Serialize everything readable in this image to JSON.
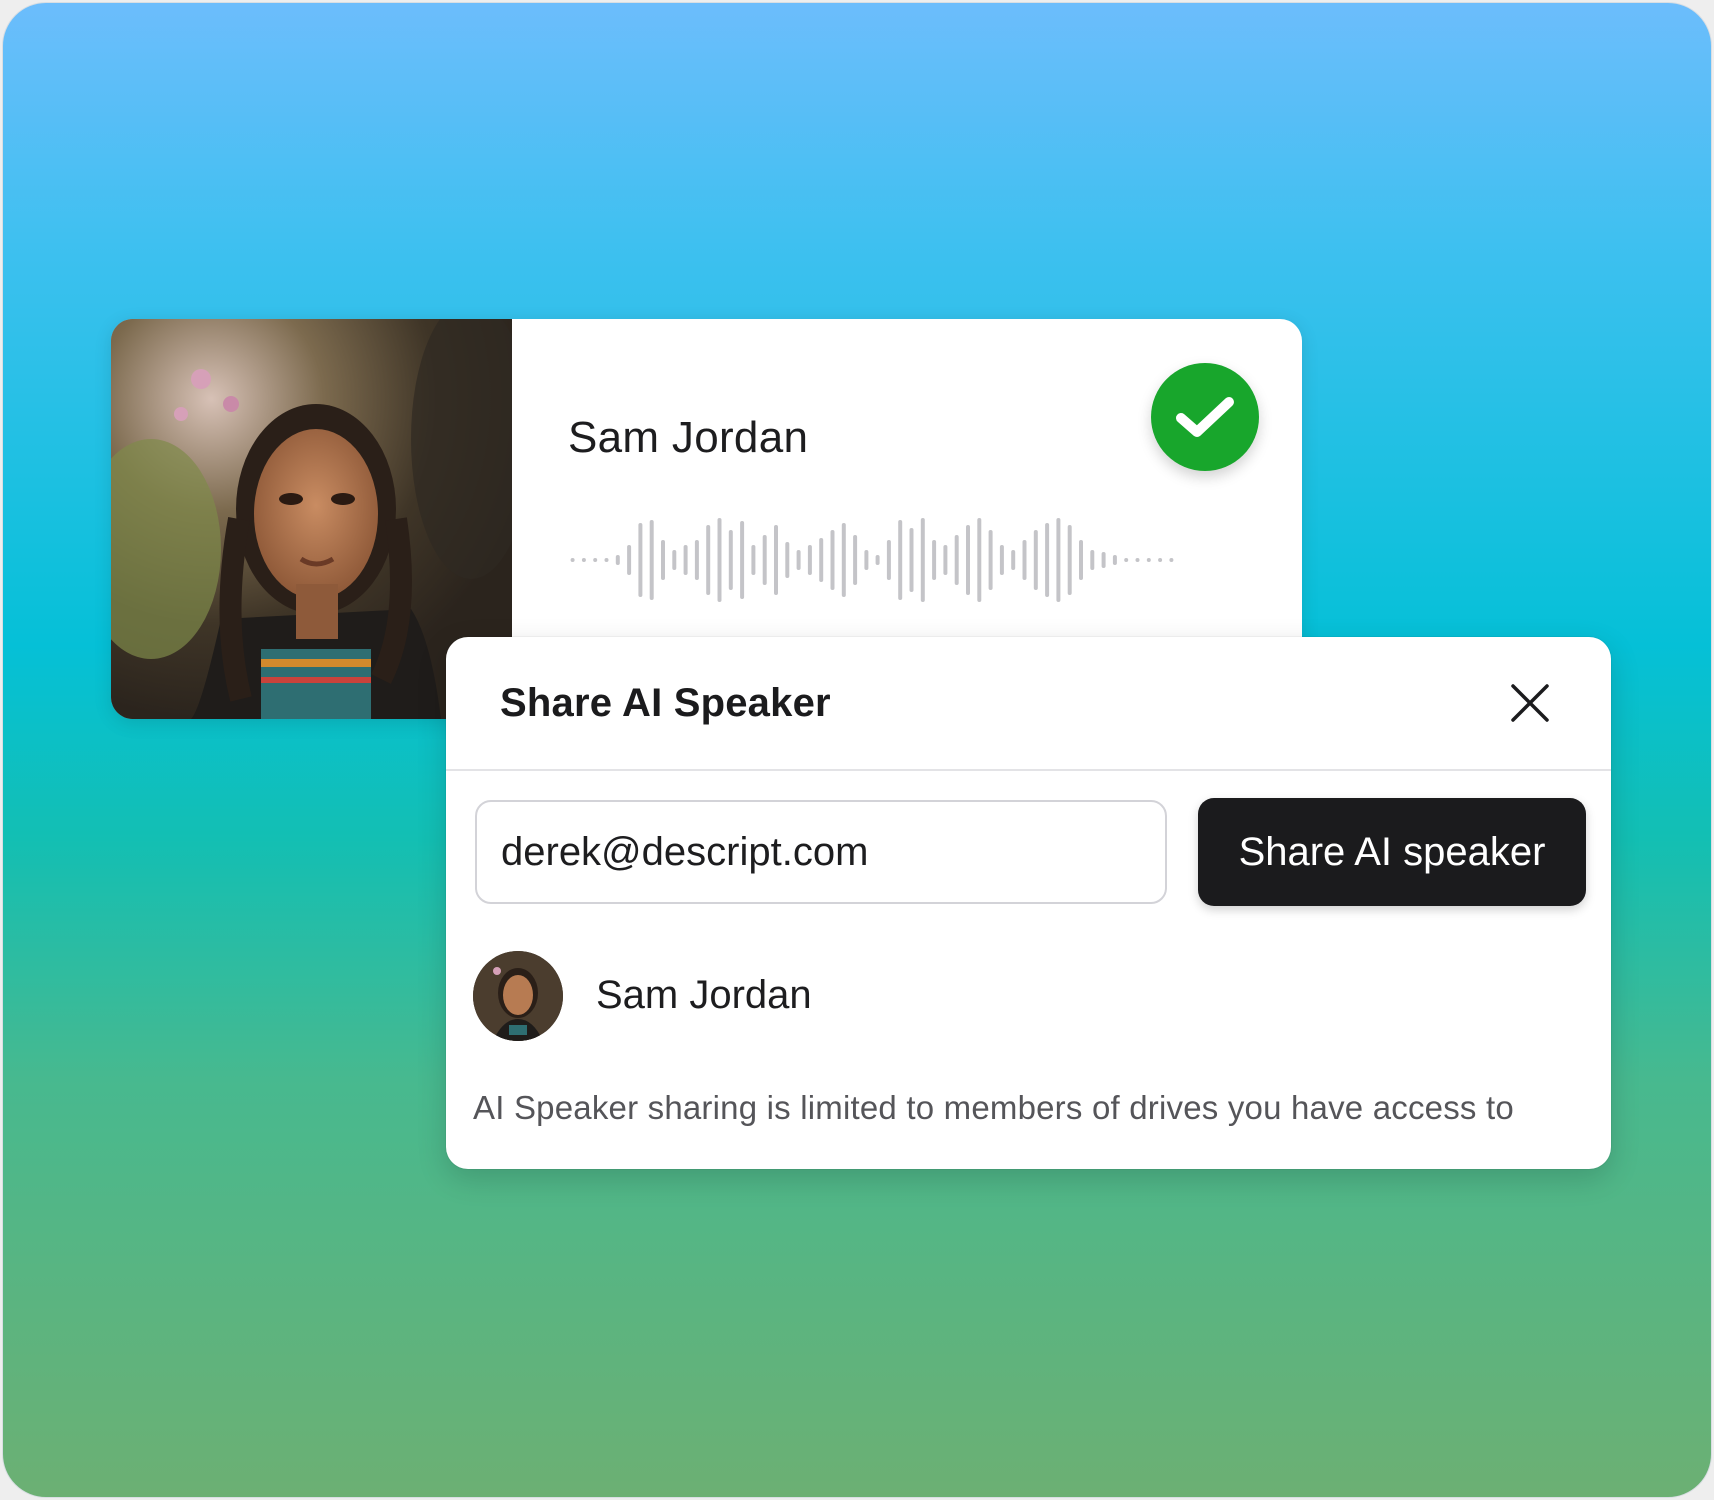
{
  "speaker_card": {
    "name": "Sam Jordan",
    "status_icon": "checkmark-icon",
    "status_color": "#18a62c"
  },
  "dialog": {
    "title": "Share AI Speaker",
    "close_icon": "close-icon",
    "email_value": "derek@descript.com",
    "share_button_label": "Share AI speaker",
    "members": [
      {
        "name": "Sam Jordan"
      }
    ],
    "note": "AI Speaker sharing is limited to members of drives you have access to"
  }
}
